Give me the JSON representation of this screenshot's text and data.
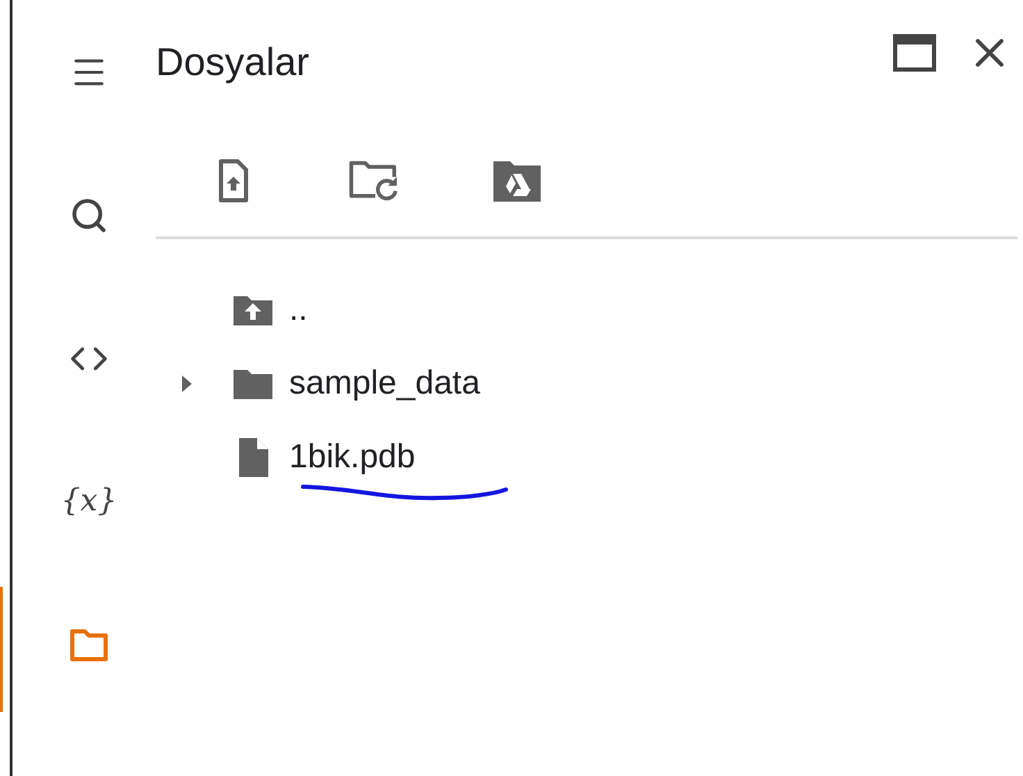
{
  "sidebar": {
    "items": [
      {
        "kind": "menu",
        "selected": false
      },
      {
        "kind": "search",
        "selected": false
      },
      {
        "kind": "code",
        "selected": false
      },
      {
        "kind": "variables",
        "label": "{x}",
        "selected": false
      },
      {
        "kind": "files",
        "selected": true
      }
    ]
  },
  "panel": {
    "title": "Dosyalar"
  },
  "files": [
    {
      "kind": "parent",
      "name": ".."
    },
    {
      "kind": "folder",
      "name": "sample_data",
      "expanded": false
    },
    {
      "kind": "file",
      "name": "1bik.pdb",
      "underlined": true
    }
  ]
}
